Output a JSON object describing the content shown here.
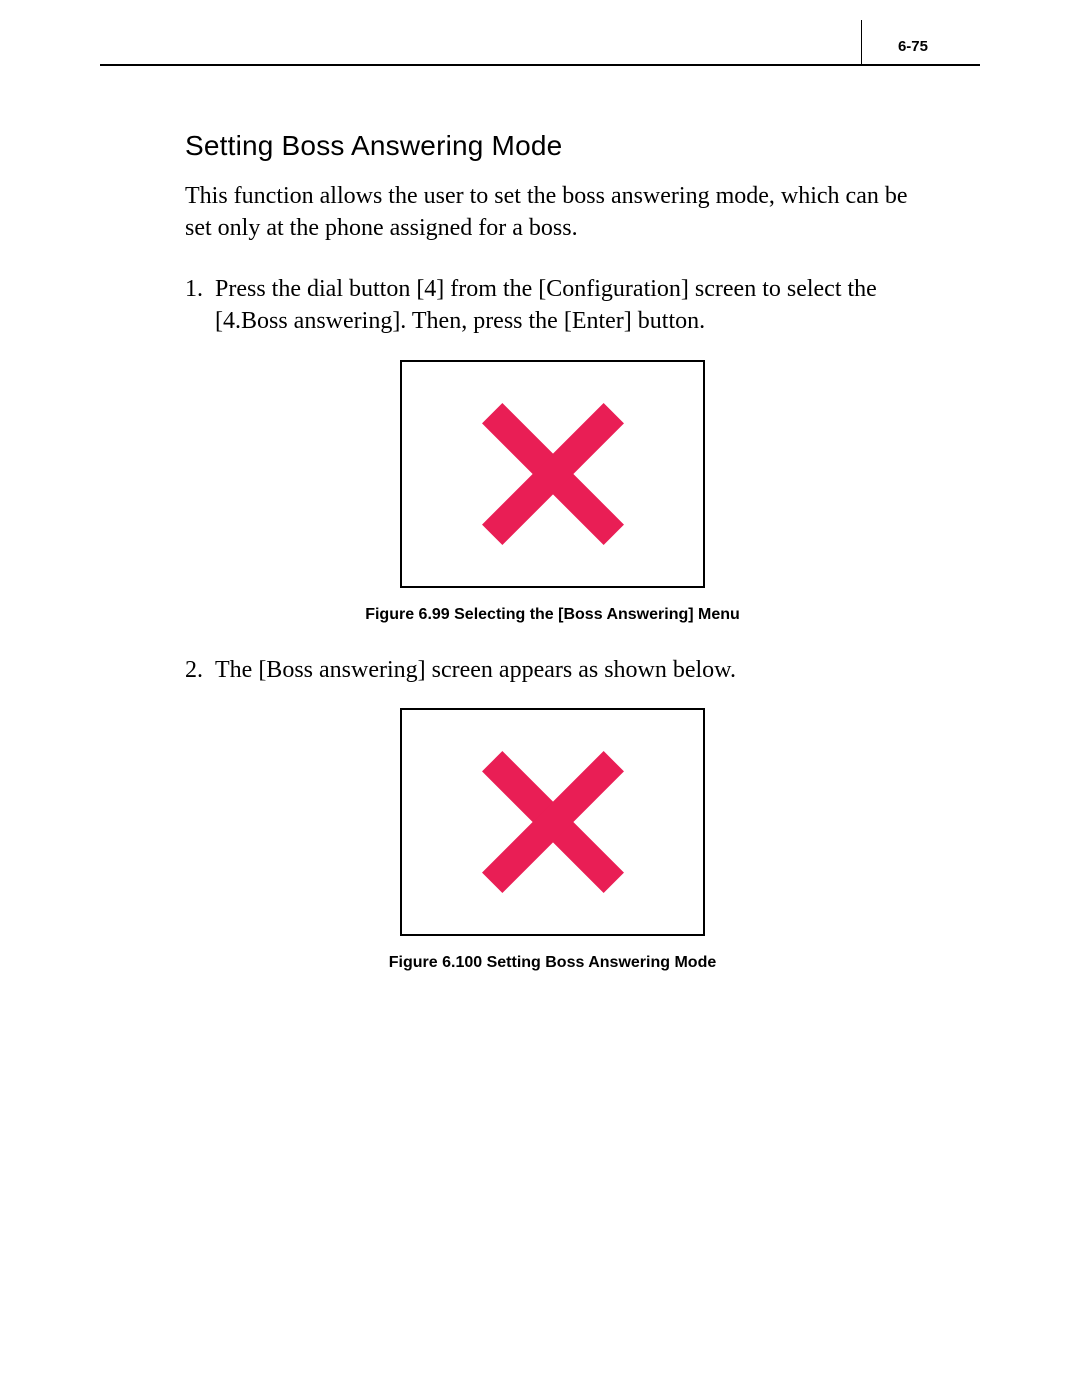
{
  "header": {
    "page_number": "6-75"
  },
  "section": {
    "title": "Setting Boss Answering Mode",
    "intro": "This function allows the user to set the boss answering mode, which can be set only at the phone assigned for a boss."
  },
  "steps": [
    {
      "num": "1.",
      "text": "Press the dial button [4] from the [Configuration] screen to select the [4.Boss answering]. Then, press the [Enter] button."
    },
    {
      "num": "2.",
      "text": "The [Boss answering] screen appears as shown below."
    }
  ],
  "figures": [
    {
      "icon": "missing-image-x",
      "caption": "Figure 6.99  Selecting the [Boss Answering] Menu"
    },
    {
      "icon": "missing-image-x",
      "caption": "Figure 6.100 Setting Boss Answering Mode"
    }
  ],
  "colors": {
    "x_stroke": "#e91e55"
  }
}
